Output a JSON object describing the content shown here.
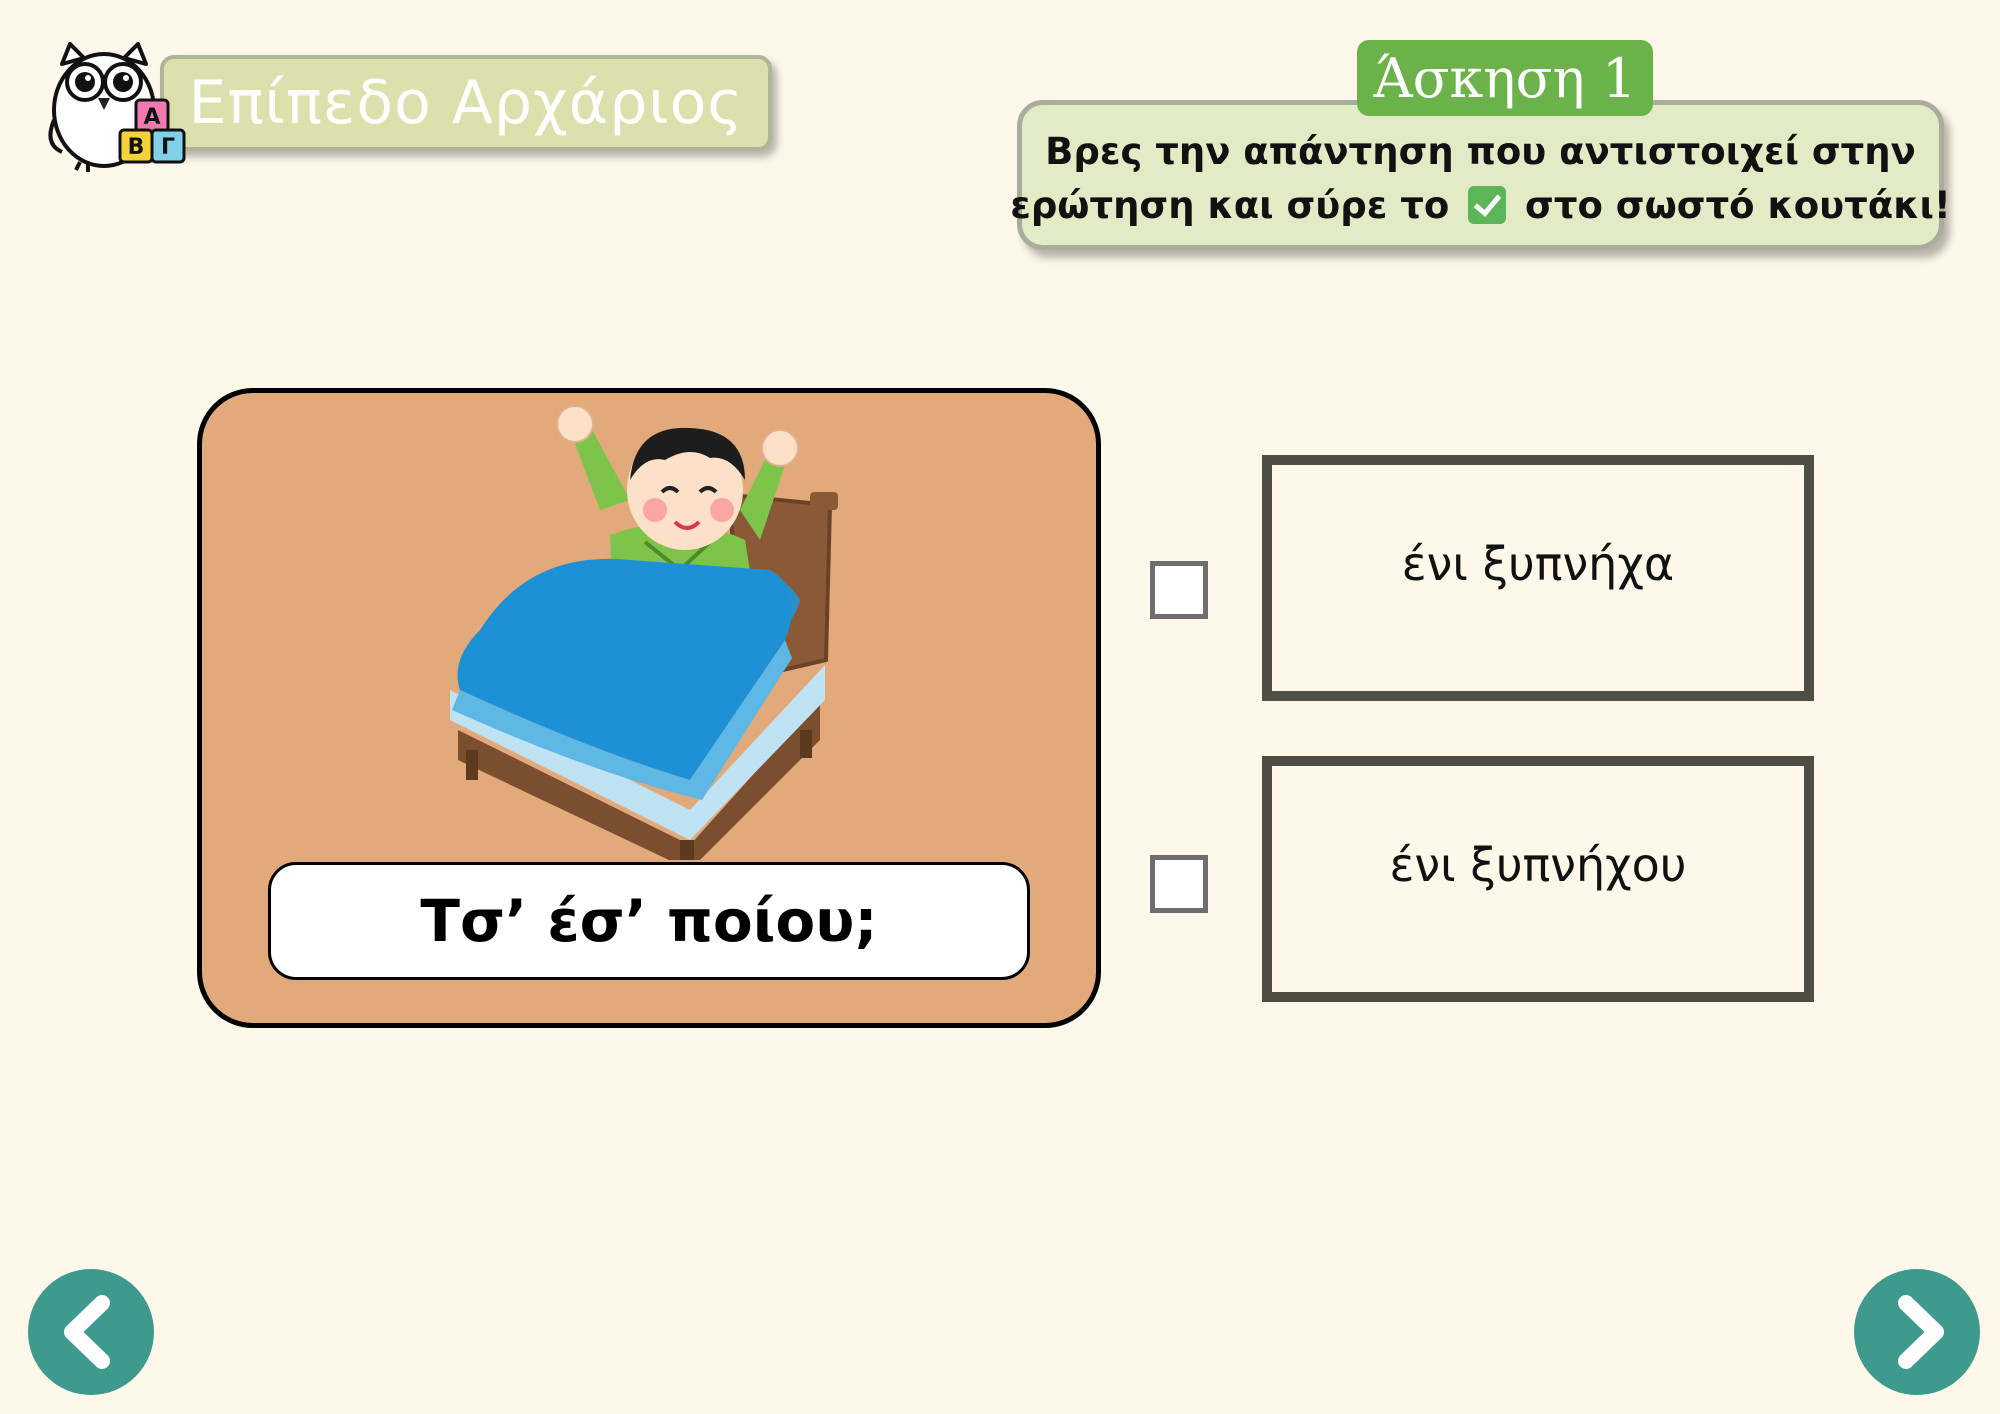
{
  "header": {
    "level_label": "Επίπεδο Αρχάριος",
    "logo_letters": [
      "Α",
      "Β",
      "Γ"
    ]
  },
  "exercise": {
    "tab_label": "Άσκηση 1",
    "instruction_line1": "Βρες την απάντηση που αντιστοιχεί στην",
    "instruction_line2_before": "ερώτηση και σύρε το",
    "instruction_line2_after": "στο σωστό κουτάκι!"
  },
  "question": {
    "text": "Τσ’ έσ’ ποίου;"
  },
  "answers": [
    {
      "label": "ένι ξυπνήχα",
      "checked": false
    },
    {
      "label": "ένι ξυπνήχου",
      "checked": false
    }
  ],
  "navigation": {
    "prev_icon": "chevron-left-icon",
    "next_icon": "chevron-right-icon"
  },
  "colors": {
    "background": "#fdf8e9",
    "card": "#e2a97a",
    "tab": "#6bb24b",
    "nav": "#3d9a8d",
    "banner": "#dbe0ad",
    "instruction_bg": "#e3ebc6"
  }
}
